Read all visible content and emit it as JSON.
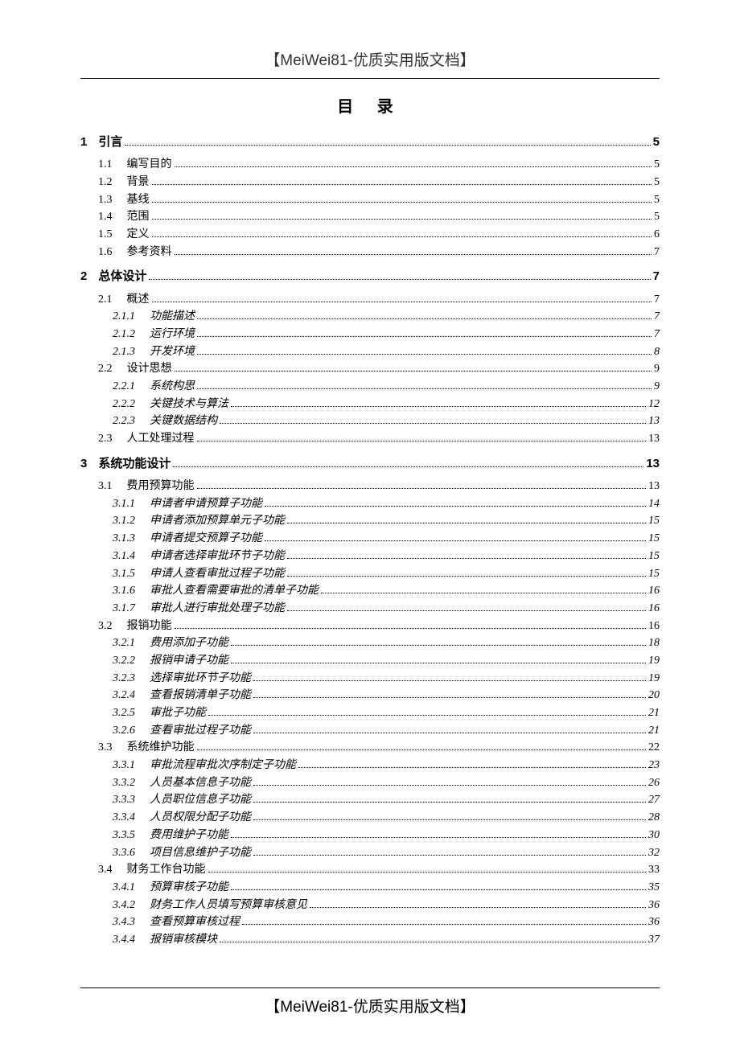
{
  "header": "【MeiWei81-优质实用版文档】",
  "tocTitle": "目 录",
  "footer": "【MeiWei81-优质实用版文档】",
  "entries": [
    {
      "level": 1,
      "num": "1",
      "txt": "引言",
      "pg": "5"
    },
    {
      "level": 2,
      "num": "1.1",
      "txt": "编写目的",
      "pg": "5"
    },
    {
      "level": 2,
      "num": "1.2",
      "txt": "背景",
      "pg": "5"
    },
    {
      "level": 2,
      "num": "1.3",
      "txt": "基线",
      "pg": "5"
    },
    {
      "level": 2,
      "num": "1.4",
      "txt": "范围",
      "pg": "5"
    },
    {
      "level": 2,
      "num": "1.5",
      "txt": "定义",
      "pg": "6"
    },
    {
      "level": 2,
      "num": "1.6",
      "txt": "参考资料",
      "pg": "7"
    },
    {
      "level": 1,
      "num": "2",
      "txt": "总体设计",
      "pg": "7"
    },
    {
      "level": 2,
      "num": "2.1",
      "txt": "概述",
      "pg": "7"
    },
    {
      "level": 3,
      "num": "2.1.1",
      "txt": "功能描述",
      "pg": "7"
    },
    {
      "level": 3,
      "num": "2.1.2",
      "txt": "运行环境",
      "pg": "7"
    },
    {
      "level": 3,
      "num": "2.1.3",
      "txt": "开发环境",
      "pg": "8"
    },
    {
      "level": 2,
      "num": "2.2",
      "txt": "设计思想",
      "pg": "9"
    },
    {
      "level": 3,
      "num": "2.2.1",
      "txt": "系统构思",
      "pg": "9"
    },
    {
      "level": 3,
      "num": "2.2.2",
      "txt": "关键技术与算法",
      "pg": "12"
    },
    {
      "level": 3,
      "num": "2.2.3",
      "txt": "关键数据结构",
      "pg": "13"
    },
    {
      "level": 2,
      "num": "2.3",
      "txt": "人工处理过程",
      "pg": "13"
    },
    {
      "level": 1,
      "num": "3",
      "txt": "系统功能设计",
      "pg": "13"
    },
    {
      "level": 2,
      "num": "3.1",
      "txt": "费用预算功能",
      "pg": "13"
    },
    {
      "level": 3,
      "num": "3.1.1",
      "txt": "申请者申请预算子功能",
      "pg": "14"
    },
    {
      "level": 3,
      "num": "3.1.2",
      "txt": "申请者添加预算单元子功能",
      "pg": "15"
    },
    {
      "level": 3,
      "num": "3.1.3",
      "txt": "申请者提交预算子功能",
      "pg": "15"
    },
    {
      "level": 3,
      "num": "3.1.4",
      "txt": "申请者选择审批环节子功能",
      "pg": "15"
    },
    {
      "level": 3,
      "num": "3.1.5",
      "txt": "申请人查看审批过程子功能",
      "pg": "15"
    },
    {
      "level": 3,
      "num": "3.1.6",
      "txt": "审批人查看需要审批的清单子功能",
      "pg": "16"
    },
    {
      "level": 3,
      "num": "3.1.7",
      "txt": "审批人进行审批处理子功能",
      "pg": "16"
    },
    {
      "level": 2,
      "num": "3.2",
      "txt": "报销功能",
      "pg": "16"
    },
    {
      "level": 3,
      "num": "3.2.1",
      "txt": "费用添加子功能",
      "pg": "18"
    },
    {
      "level": 3,
      "num": "3.2.2",
      "txt": "报销申请子功能",
      "pg": "19"
    },
    {
      "level": 3,
      "num": "3.2.3",
      "txt": "选择审批环节子功能",
      "pg": "19"
    },
    {
      "level": 3,
      "num": "3.2.4",
      "txt": "查看报销清单子功能",
      "pg": "20"
    },
    {
      "level": 3,
      "num": "3.2.5",
      "txt": "审批子功能",
      "pg": "21"
    },
    {
      "level": 3,
      "num": "3.2.6",
      "txt": "查看审批过程子功能",
      "pg": "21"
    },
    {
      "level": 2,
      "num": "3.3",
      "txt": "系统维护功能",
      "pg": "22"
    },
    {
      "level": 3,
      "num": "3.3.1",
      "txt": "审批流程审批次序制定子功能",
      "pg": "23"
    },
    {
      "level": 3,
      "num": "3.3.2",
      "txt": "人员基本信息子功能",
      "pg": "26"
    },
    {
      "level": 3,
      "num": "3.3.3",
      "txt": "人员职位信息子功能",
      "pg": "27"
    },
    {
      "level": 3,
      "num": "3.3.4",
      "txt": "人员权限分配子功能",
      "pg": "28"
    },
    {
      "level": 3,
      "num": "3.3.5",
      "txt": "费用维护子功能",
      "pg": "30"
    },
    {
      "level": 3,
      "num": "3.3.6",
      "txt": "项目信息维护子功能",
      "pg": "32"
    },
    {
      "level": 2,
      "num": "3.4",
      "txt": "财务工作台功能",
      "pg": "33"
    },
    {
      "level": 3,
      "num": "3.4.1",
      "txt": "预算审核子功能",
      "pg": "35"
    },
    {
      "level": 3,
      "num": "3.4.2",
      "txt": "财务工作人员填写预算审核意见",
      "pg": "36"
    },
    {
      "level": 3,
      "num": "3.4.3",
      "txt": "查看预算审核过程",
      "pg": "36"
    },
    {
      "level": 3,
      "num": "3.4.4",
      "txt": "报销审核模块",
      "pg": "37"
    }
  ]
}
